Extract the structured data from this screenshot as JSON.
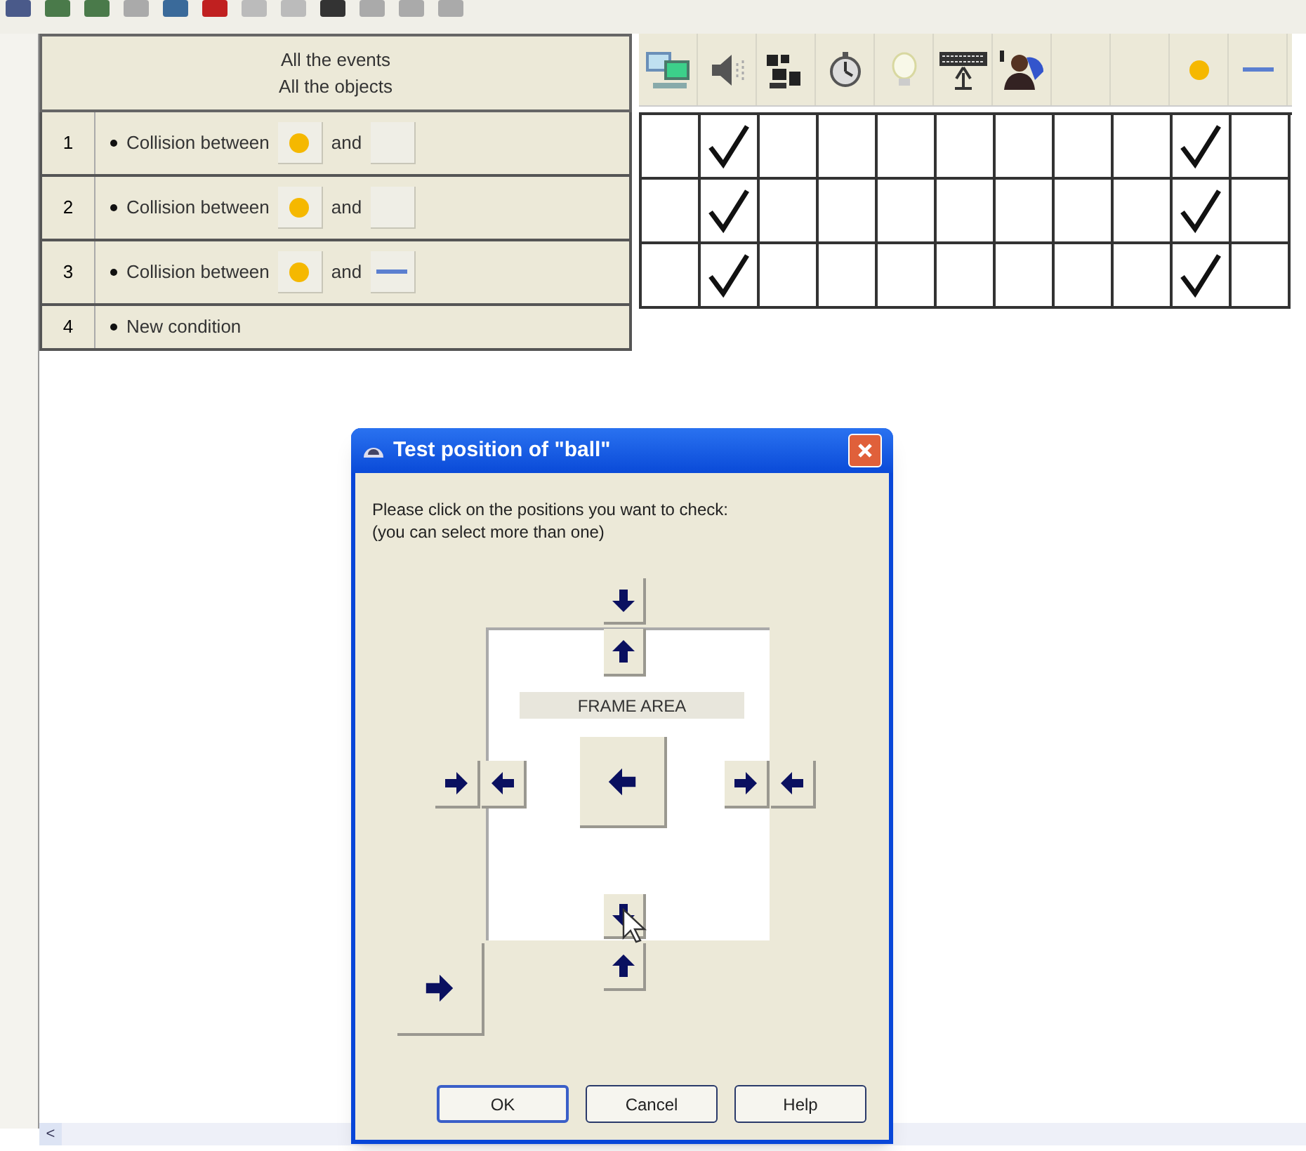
{
  "event_list": {
    "header": [
      "All the events",
      "All the objects"
    ],
    "rows": [
      {
        "number": "1",
        "parts": [
          {
            "kind": "text",
            "text": "Collision between"
          },
          {
            "kind": "ball"
          },
          {
            "kind": "text",
            "text": "and"
          },
          {
            "kind": "empty"
          }
        ]
      },
      {
        "number": "2",
        "parts": [
          {
            "kind": "text",
            "text": "Collision between"
          },
          {
            "kind": "ball"
          },
          {
            "kind": "text",
            "text": "and"
          },
          {
            "kind": "empty"
          }
        ]
      },
      {
        "number": "3",
        "parts": [
          {
            "kind": "text",
            "text": "Collision between"
          },
          {
            "kind": "ball"
          },
          {
            "kind": "text",
            "text": "and"
          },
          {
            "kind": "line"
          }
        ]
      },
      {
        "number": "4",
        "parts": [
          {
            "kind": "text",
            "text": "New condition"
          }
        ]
      }
    ]
  },
  "grid": {
    "columns": [
      {
        "kind": "computer"
      },
      {
        "kind": "speaker"
      },
      {
        "kind": "storyboard"
      },
      {
        "kind": "timer"
      },
      {
        "kind": "bulb"
      },
      {
        "kind": "keyboard"
      },
      {
        "kind": "player"
      },
      {
        "kind": "empty"
      },
      {
        "kind": "empty"
      },
      {
        "kind": "ball"
      },
      {
        "kind": "line"
      }
    ],
    "rows": [
      {
        "cells": [
          {
            "checked": false
          },
          {
            "checked": true
          },
          {
            "checked": false
          },
          {
            "checked": false
          },
          {
            "checked": false
          },
          {
            "checked": false
          },
          {
            "checked": false
          },
          {
            "checked": false
          },
          {
            "checked": false
          },
          {
            "checked": true
          },
          {
            "checked": false
          }
        ]
      },
      {
        "cells": [
          {
            "checked": false
          },
          {
            "checked": true
          },
          {
            "checked": false
          },
          {
            "checked": false
          },
          {
            "checked": false
          },
          {
            "checked": false
          },
          {
            "checked": false
          },
          {
            "checked": false
          },
          {
            "checked": false
          },
          {
            "checked": true
          },
          {
            "checked": false
          }
        ]
      },
      {
        "cells": [
          {
            "checked": false
          },
          {
            "checked": true
          },
          {
            "checked": false
          },
          {
            "checked": false
          },
          {
            "checked": false
          },
          {
            "checked": false
          },
          {
            "checked": false
          },
          {
            "checked": false
          },
          {
            "checked": false
          },
          {
            "checked": true
          },
          {
            "checked": false
          }
        ]
      }
    ]
  },
  "dialog": {
    "title": "Test position of \"ball\"",
    "instructions": [
      "Please click on the positions you want to check:",
      "(you can select more than one)"
    ],
    "frame_label": "FRAME AREA",
    "buttons": [
      "OK",
      "Cancel",
      "Help"
    ]
  },
  "scrollbar": {
    "left_button": "<"
  }
}
